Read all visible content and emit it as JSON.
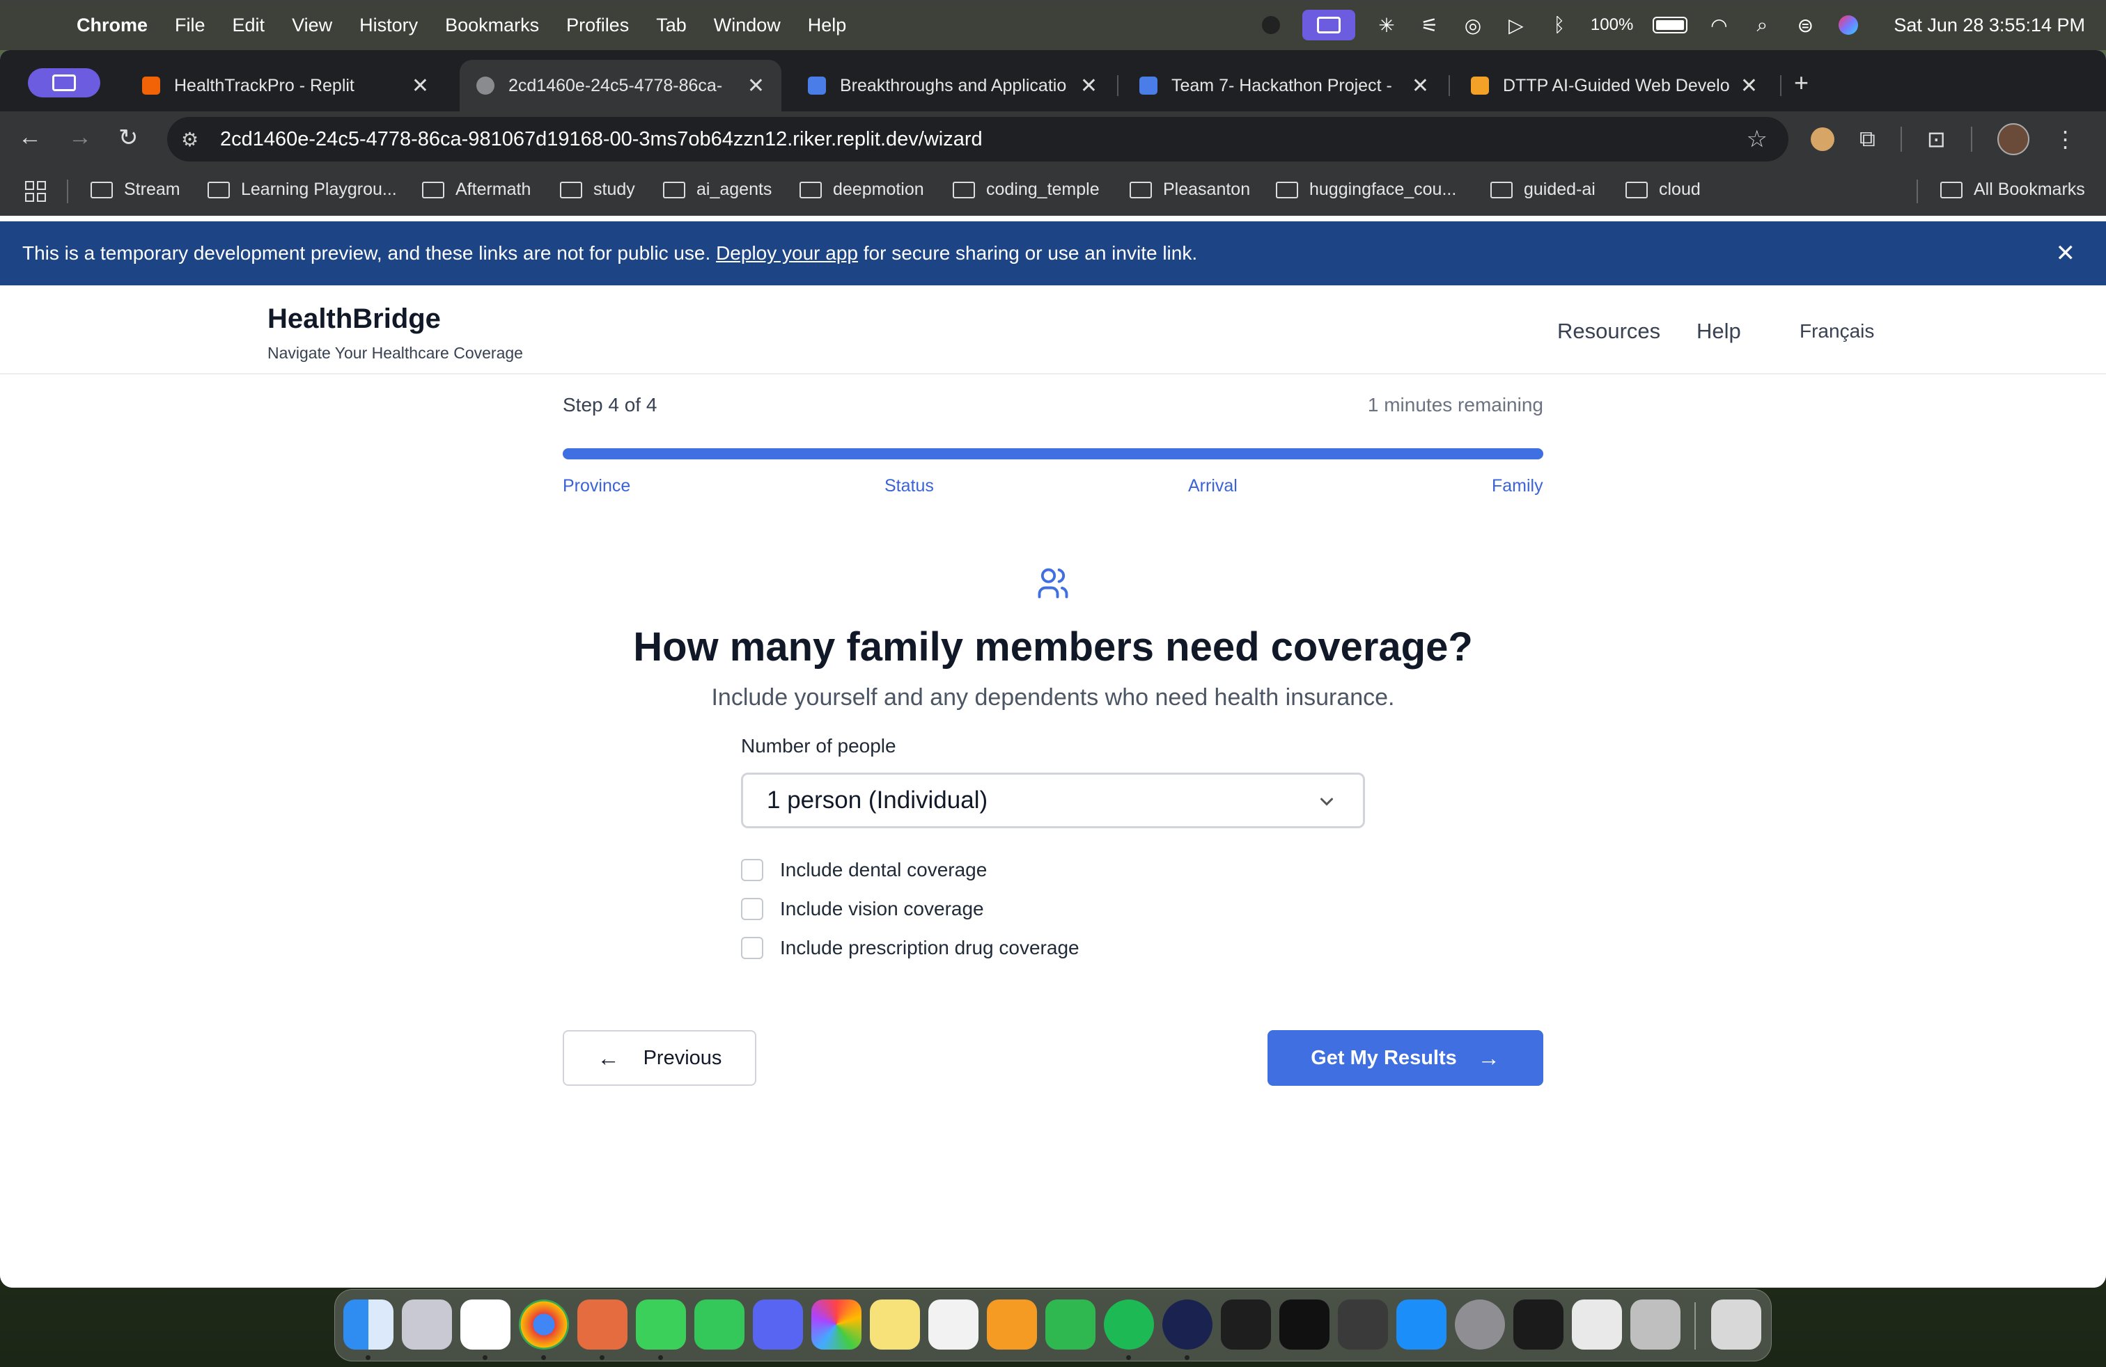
{
  "menubar": {
    "app": "Chrome",
    "items": [
      "File",
      "Edit",
      "View",
      "History",
      "Bookmarks",
      "Profiles",
      "Tab",
      "Window",
      "Help"
    ],
    "battery": "100%",
    "datetime": "Sat Jun 28  3:55:14 PM"
  },
  "tabs": [
    {
      "title": "HealthTrackPro - Replit",
      "favicon_color": "#f26207",
      "active": false
    },
    {
      "title": "2cd1460e-24c5-4778-86ca-",
      "favicon_color": "#8a8b8e",
      "active": true
    },
    {
      "title": "Breakthroughs and Applicatio",
      "favicon_color": "#4a7de8",
      "active": false
    },
    {
      "title": "Team 7- Hackathon Project - ",
      "favicon_color": "#4a7de8",
      "active": false
    },
    {
      "title": "DTTP AI-Guided Web Develop",
      "favicon_color": "#f4a227",
      "active": false
    }
  ],
  "omnibox": {
    "url": "2cd1460e-24c5-4778-86ca-981067d19168-00-3ms7ob64zzn12.riker.replit.dev/wizard"
  },
  "bookmarks": [
    "Stream",
    "Learning Playgrou...",
    "Aftermath",
    "study",
    "ai_agents",
    "deepmotion",
    "coding_temple",
    "Pleasanton",
    "huggingface_cou...",
    "guided-ai",
    "cloud"
  ],
  "all_bookmarks": "All Bookmarks",
  "banner": {
    "text_before": "This is a temporary development preview, and these links are not for public use. ",
    "link": "Deploy your app",
    "text_after": " for secure sharing or use an invite link."
  },
  "header": {
    "brand": "HealthBridge",
    "tagline": "Navigate Your Healthcare Coverage",
    "nav": [
      "Resources",
      "Help",
      "Français"
    ]
  },
  "wizard": {
    "step": "Step 4 of 4",
    "remaining": "1 minutes remaining",
    "progress_fraction": 1.0,
    "steps": [
      "Province",
      "Status",
      "Arrival",
      "Family"
    ],
    "question": "How many family members need coverage?",
    "subtitle": "Include yourself and any dependents who need health insurance.",
    "field_label": "Number of people",
    "selected": "1 person (Individual)",
    "checkboxes": [
      "Include dental coverage",
      "Include vision coverage",
      "Include prescription drug coverage"
    ],
    "prev_label": "Previous",
    "next_label": "Get My Results"
  },
  "colors": {
    "accent": "#3f6fe0",
    "banner": "#1d4585"
  }
}
